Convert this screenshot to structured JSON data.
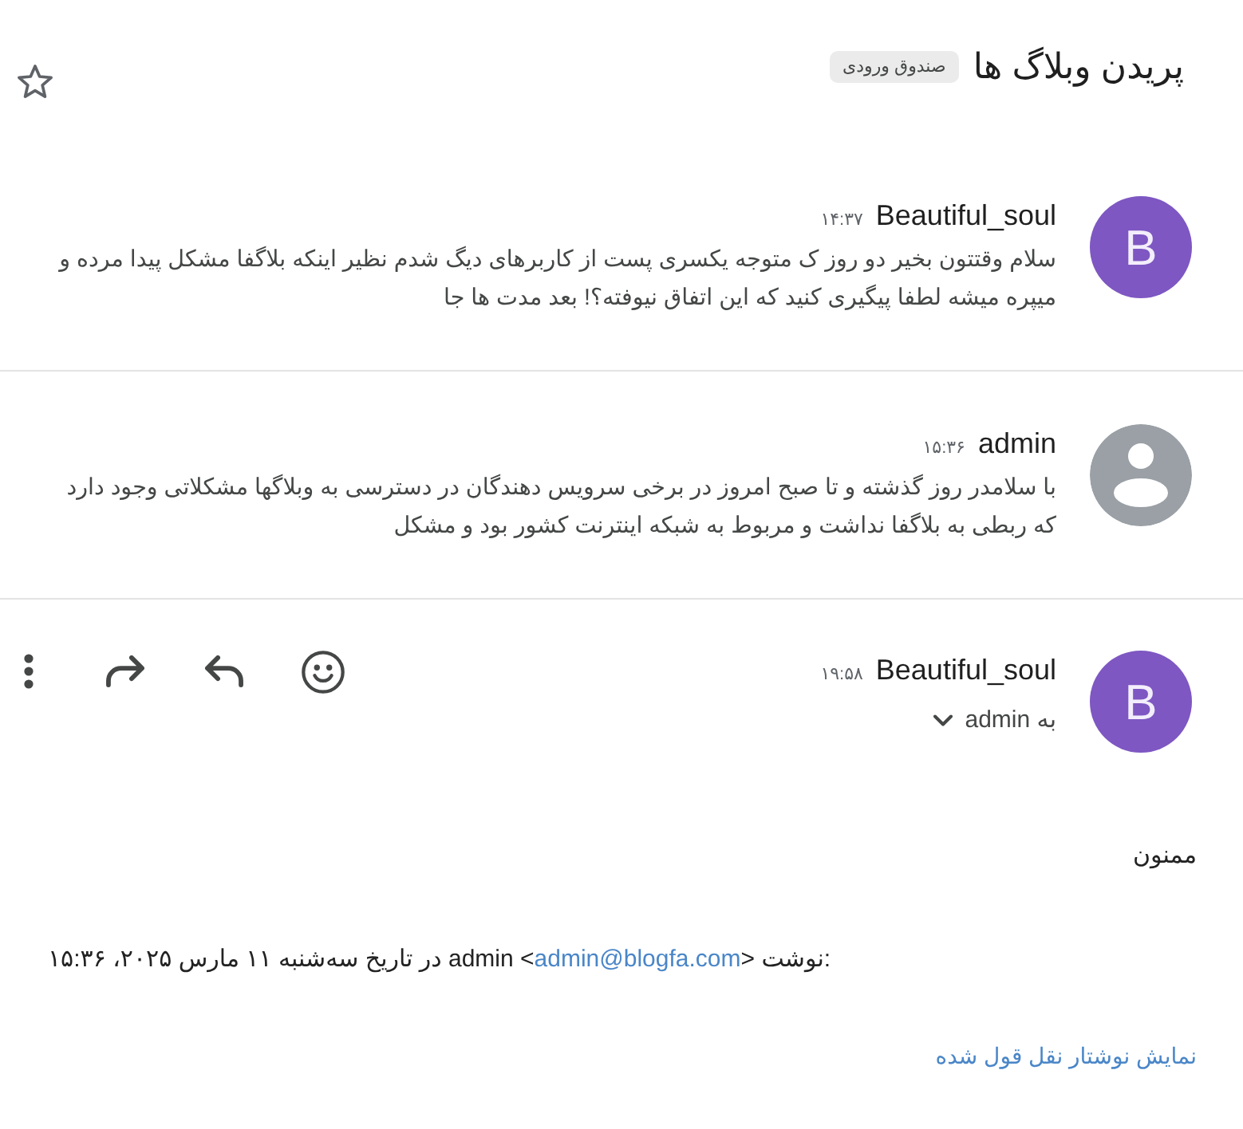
{
  "subject": {
    "title": "پریدن وبلاگ ها",
    "label": "صندوق ورودی",
    "starred": false
  },
  "messages": [
    {
      "kind": "collapsed",
      "avatar": {
        "kind": "letter",
        "letter": "B",
        "color": "#7e57c2"
      },
      "sender": "Beautiful_soul",
      "time": "۱۴:۳۷",
      "snippet": "سلام وقتتون بخیر دو روز ک متوجه یکسری پست از کاربرهای دیگ شدم نظیر اینکه بلاگفا مشکل پیدا مرده و میپره میشه لطفا پیگیری کنید که این اتفاق نیوفته؟! بعد مدت ها جا"
    },
    {
      "kind": "collapsed",
      "avatar": {
        "kind": "person",
        "color": "#9aa0a6"
      },
      "sender": "admin",
      "time": "۱۵:۳۶",
      "snippet": "با سلامدر روز گذشته و تا صبح امروز در برخی سرویس دهندگان در دسترسی به وبلاگها مشکلاتی وجود دارد که ربطی به بلاگفا نداشت و مربوط به شبکه اینترنت کشور بود و مشکل"
    },
    {
      "kind": "expanded",
      "avatar": {
        "kind": "letter",
        "letter": "B",
        "color": "#7e57c2"
      },
      "sender": "Beautiful_soul",
      "time": "۱۹:۵۸",
      "recipients": "به admin",
      "body": "ممنون",
      "quote_header": {
        "before": "در تاریخ سه‌شنبه ۱۱ مارس ۲۰۲۵، ۱۵:۳۶ admin <",
        "email": "admin@blogfa.com",
        "after": "> نوشت:"
      },
      "show_quoted": "نمایش نوشتار نقل قول شده"
    }
  ]
}
